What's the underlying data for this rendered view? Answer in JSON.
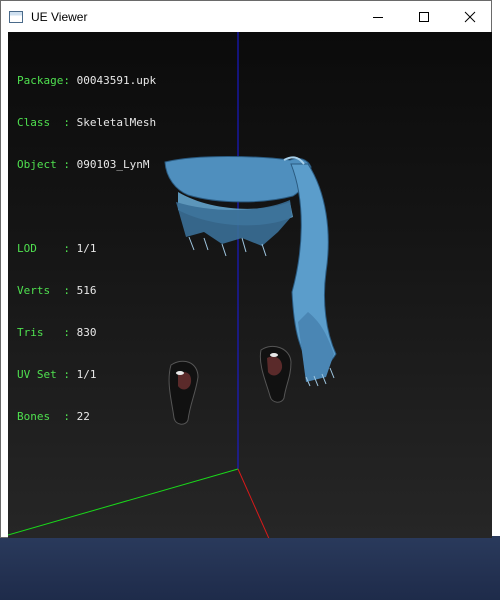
{
  "window": {
    "title": "UE Viewer",
    "app_icon": "window-app-icon",
    "controls": {
      "minimize_icon": "minimize-icon",
      "maximize_icon": "maximize-icon",
      "close_icon": "close-icon"
    }
  },
  "info": {
    "package_label": "Package: ",
    "package_value": "00043591.upk",
    "class_label": "Class  : ",
    "class_value": "SkeletalMesh",
    "object_label": "Object : ",
    "object_value": "090103_LynM",
    "lod_label": "LOD    : ",
    "lod_value": "1/1",
    "verts_label": "Verts  : ",
    "verts_value": "516",
    "tris_label": "Tris   : ",
    "tris_value": "830",
    "uvset_label": "UV Set : ",
    "uvset_value": "1/1",
    "bones_label": "Bones  : ",
    "bones_value": "22"
  },
  "colors": {
    "label_text": "#4fe04f",
    "value_text": "#e8e8e8",
    "axis_x": "#e01010",
    "axis_y": "#10e010",
    "axis_z": "#1010e0",
    "mesh": "#5a9ac8"
  }
}
